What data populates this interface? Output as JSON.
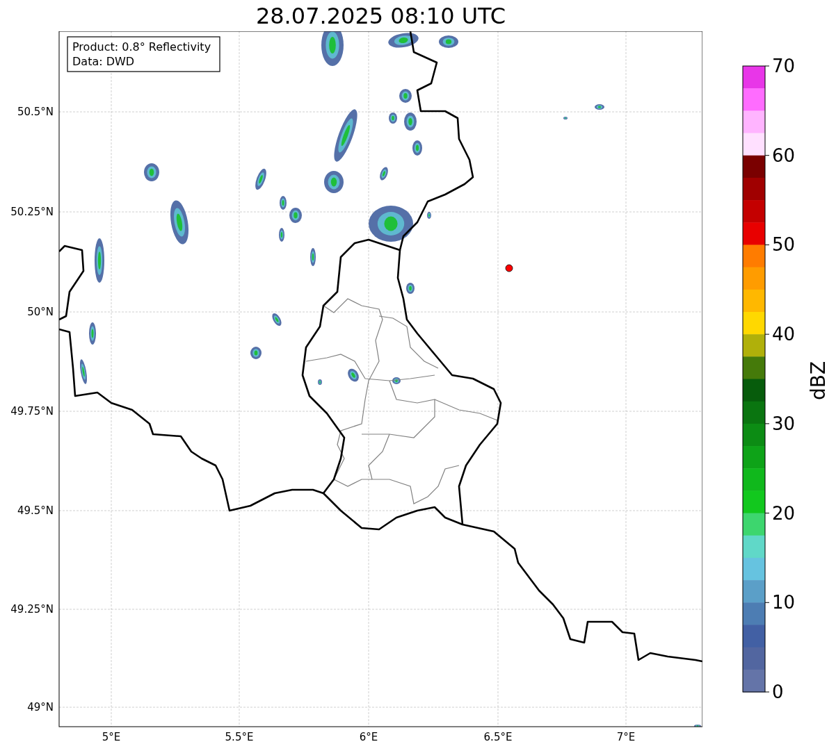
{
  "title": "28.07.2025 08:10 UTC",
  "info_box": {
    "lines": [
      "Product: 0.8° Reflectivity",
      "Data: DWD"
    ]
  },
  "map": {
    "lat_labels": [
      "50.5°N",
      "50.25°N",
      "50°N",
      "49.75°N",
      "49.5°N",
      "49.25°N",
      "49°N"
    ],
    "lon_labels": [
      "5°E",
      "5.5°E",
      "6°E",
      "6.5°E",
      "7°E"
    ]
  },
  "colorbar": {
    "label": "dBZ",
    "ticks": [
      "70",
      "60",
      "50",
      "40",
      "30",
      "20",
      "10",
      "0"
    ],
    "segments": [
      {
        "color": "#e836e8"
      },
      {
        "color": "#ff6cff"
      },
      {
        "color": "#ffb4ff"
      },
      {
        "color": "#ffe0ff"
      },
      {
        "color": "#7a0000"
      },
      {
        "color": "#a00000"
      },
      {
        "color": "#c40000"
      },
      {
        "color": "#e80000"
      },
      {
        "color": "#ff7c00"
      },
      {
        "color": "#ff9c00"
      },
      {
        "color": "#ffb800"
      },
      {
        "color": "#ffd800"
      },
      {
        "color": "#b0b00a"
      },
      {
        "color": "#457a0a"
      },
      {
        "color": "#075c0c"
      },
      {
        "color": "#0a7510"
      },
      {
        "color": "#0c8c14"
      },
      {
        "color": "#0ea318"
      },
      {
        "color": "#10b81c"
      },
      {
        "color": "#12c81e"
      },
      {
        "color": "#3dd66e"
      },
      {
        "color": "#60d8c8"
      },
      {
        "color": "#66c3e0"
      },
      {
        "color": "#5b9fc8"
      },
      {
        "color": "#4d7db3"
      },
      {
        "color": "#4260a4"
      },
      {
        "color": "#5266a0"
      },
      {
        "color": "#6474a8"
      }
    ]
  }
}
